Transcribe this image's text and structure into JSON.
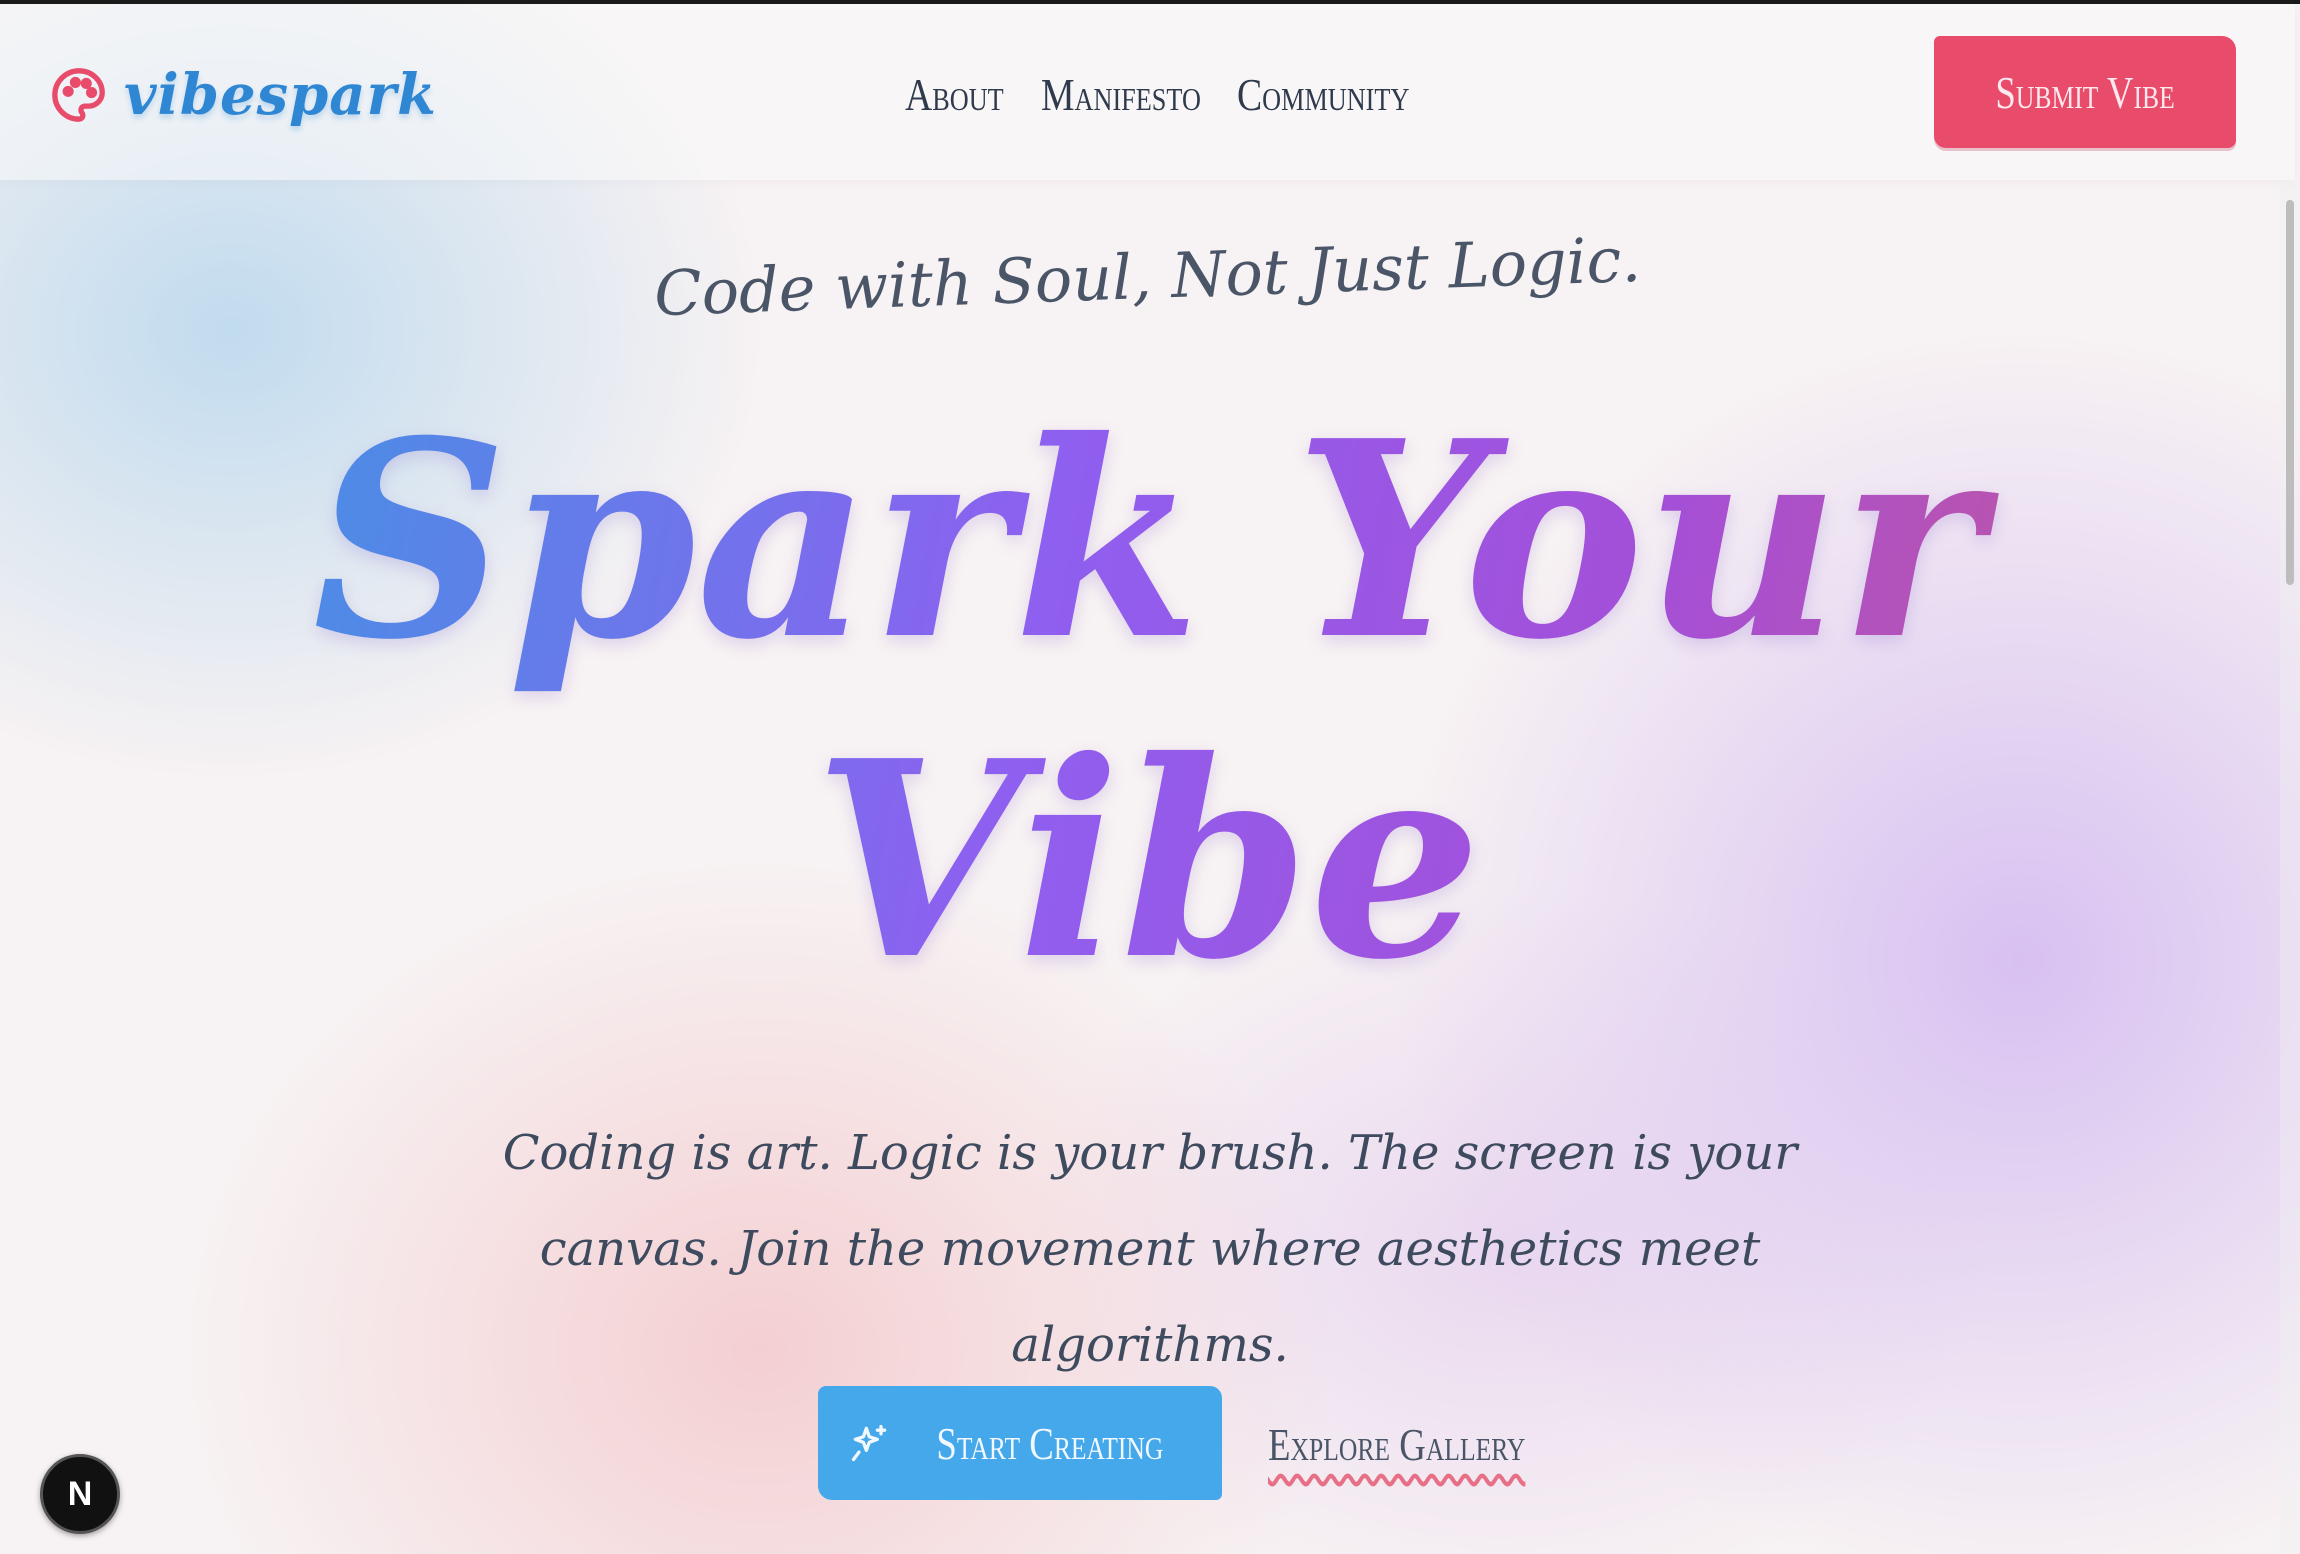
{
  "header": {
    "brand": "vibespark",
    "brand_icon": "palette-icon",
    "nav": [
      "About",
      "Manifesto",
      "Community"
    ],
    "submit_label": "Submit Vibe"
  },
  "hero": {
    "tagline": "Code with Soul, Not Just Logic.",
    "title_line1": "Spark Your",
    "title_line2": "Vibe",
    "description": "Coding is art. Logic is your brush. The screen is your canvas. Join the movement where aesthetics meet algorithms.",
    "primary_cta": "Start Creating",
    "primary_cta_icon": "sparkles-icon",
    "secondary_cta": "Explore Gallery"
  },
  "devtools": {
    "badge": "N"
  },
  "colors": {
    "brand": "#2f86d3",
    "submit_button": "#e94b6a",
    "start_button": "#45a8ea",
    "title_gradient": [
      "#4f8ae6",
      "#8f5ff0",
      "#c0559f"
    ],
    "wavy_underline": "#e76f86"
  }
}
